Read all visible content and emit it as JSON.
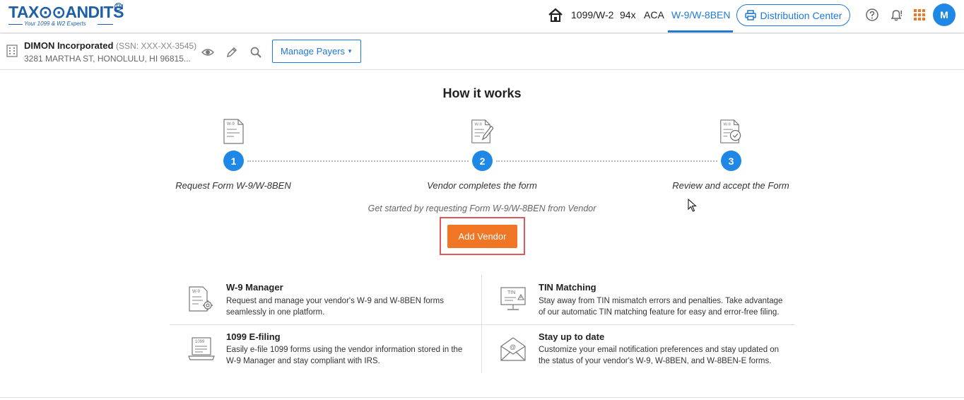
{
  "logo": {
    "main": "TAX⊙⊙ANDITS",
    "tm": "TM",
    "tagline": "Your 1099 & W2 Experts"
  },
  "nav": {
    "items": [
      {
        "label": "1099/W-2"
      },
      {
        "label": "94x"
      },
      {
        "label": "ACA"
      },
      {
        "label": "W-9/W-8BEN"
      }
    ],
    "active": "W-9/W-8BEN",
    "distribution_label": "Distribution Center",
    "avatar_initial": "M"
  },
  "payer": {
    "name": "DIMON Incorporated",
    "ssn": "(SSN: XXX-XX-3545)",
    "address": "3281 MARTHA ST, HONOLULU, HI 96815...",
    "manage_label": "Manage Payers"
  },
  "how_it_works": {
    "title": "How it works",
    "steps": [
      {
        "number": "1",
        "label": "Request Form W-9/W-8BEN"
      },
      {
        "number": "2",
        "label": "Vendor completes the form"
      },
      {
        "number": "3",
        "label": "Review and accept the Form"
      }
    ],
    "get_started": "Get started by requesting Form W-9/W-8BEN from Vendor",
    "add_vendor_label": "Add Vendor"
  },
  "features": [
    {
      "title": "W-9 Manager",
      "desc": "Request and manage your vendor's W-9 and W-8BEN forms seamlessly in one platform.",
      "icon_text": "W-9"
    },
    {
      "title": "TIN Matching",
      "desc": "Stay away from TIN mismatch errors and penalties. Take advantage of our automatic TIN matching feature for easy and error-free filing.",
      "icon_text": "TIN"
    },
    {
      "title": "1099 E-filing",
      "desc": "Easily e-file 1099 forms using the vendor information stored in the W-9 Manager and stay compliant with IRS.",
      "icon_text": "1099"
    },
    {
      "title": "Stay up to date",
      "desc": "Customize your email notification preferences and stay updated on the status of your vendor's W-9, W-8BEN, and W-8BEN-E forms.",
      "icon_text": "@"
    }
  ],
  "step_doc_text": "W-9",
  "colors": {
    "primary": "#1f7ad4",
    "accent_orange": "#f07525",
    "highlight_red": "#e0575c"
  }
}
